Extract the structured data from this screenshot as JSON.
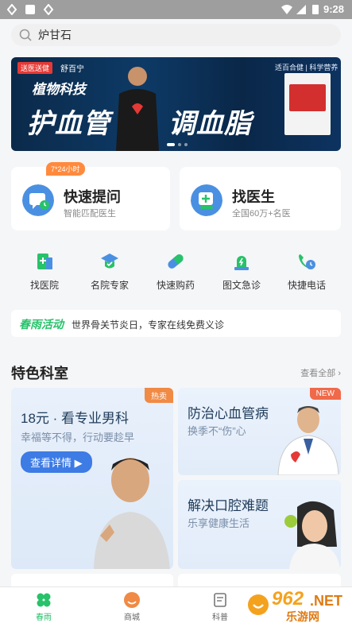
{
  "status_bar": {
    "time": "9:28"
  },
  "search": {
    "value": "炉甘石",
    "placeholder": ""
  },
  "banner": {
    "tag": "送医送健",
    "brand": "舒百宁",
    "subtitle": "植物科技",
    "headline_left": "护血管",
    "headline_right": "调血脂",
    "side_text": "适百合健 | 科学营养"
  },
  "cards": {
    "ask": {
      "badge": "7*24小时",
      "title": "快速提问",
      "subtitle": "智能匹配医生"
    },
    "doctor": {
      "title": "找医生",
      "subtitle": "全国60万+名医"
    }
  },
  "quick_menu": [
    {
      "label": "找医院",
      "icon": "hospital-icon"
    },
    {
      "label": "名院专家",
      "icon": "expert-icon"
    },
    {
      "label": "快速购药",
      "icon": "pill-icon"
    },
    {
      "label": "图文急诊",
      "icon": "emergency-icon"
    },
    {
      "label": "快捷电话",
      "icon": "phone-icon"
    }
  ],
  "activity": {
    "logo": "春雨活动",
    "text": "世界骨关节炎日，专家在线免费义诊"
  },
  "section": {
    "title": "特色科室",
    "more": "查看全部"
  },
  "features": {
    "main": {
      "tag": "热卖",
      "title": "18元 · 看专业男科",
      "subtitle": "幸福等不得，行动要趁早",
      "button": "查看详情"
    },
    "heart": {
      "tag": "NEW",
      "title": "防治心血管病",
      "subtitle": "换季不“伤”心"
    },
    "mouth": {
      "title": "解决口腔难题",
      "subtitle": "乐享健康生活"
    }
  },
  "tabbar": [
    {
      "label": "春雨",
      "icon": "clover-icon",
      "active": true
    },
    {
      "label": "商城",
      "icon": "mall-icon",
      "active": false
    },
    {
      "label": "科普",
      "icon": "article-icon",
      "active": false
    }
  ],
  "watermark": {
    "number": "962",
    "suffix": ".NET",
    "text": "乐游网"
  },
  "colors": {
    "accent_green": "#27c26a",
    "primary_blue": "#3d7be5",
    "hot_orange": "#f08a44"
  }
}
